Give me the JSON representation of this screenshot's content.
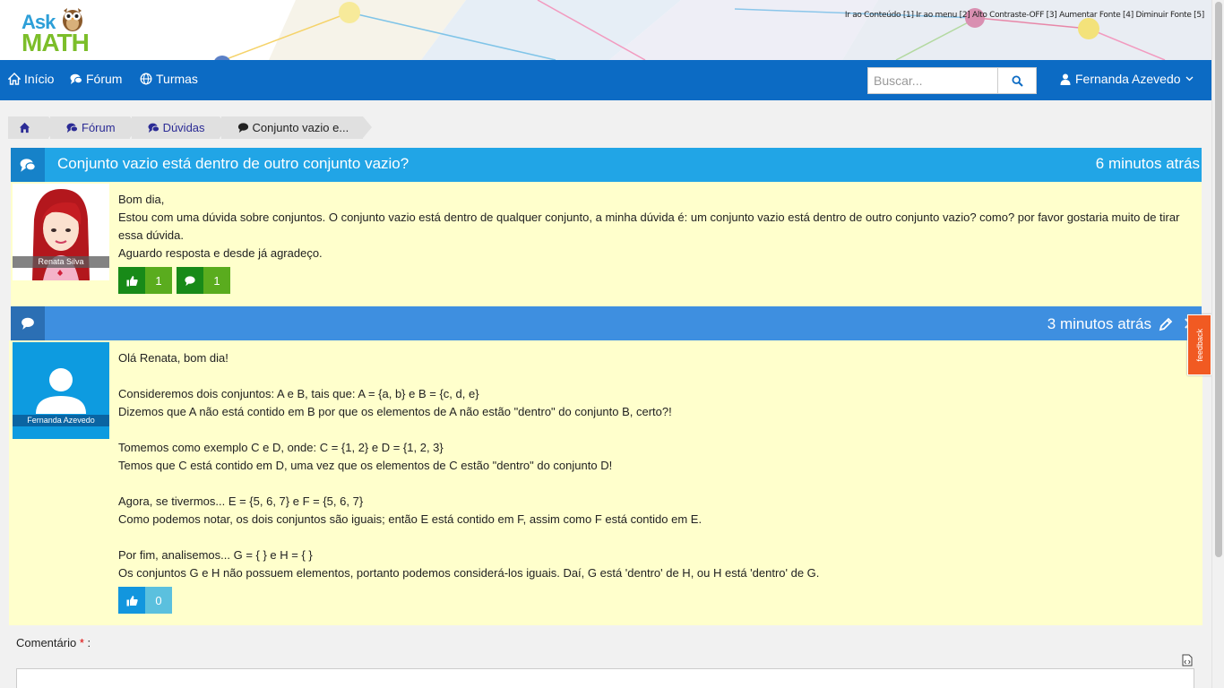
{
  "app": {
    "logo_top": "Ask",
    "logo_bottom": "MATH"
  },
  "accessibility": [
    "Ir ao Conteúdo [1]",
    "Ir ao menu [2]",
    "Alto Contraste-OFF [3]",
    "Aumentar Fonte [4]",
    "Diminuir Fonte [5]"
  ],
  "nav": {
    "home": "Início",
    "forum": "Fórum",
    "classes": "Turmas",
    "search_placeholder": "Buscar...",
    "user": "Fernanda Azevedo"
  },
  "breadcrumb": {
    "forum": "Fórum",
    "doubts": "Dúvidas",
    "current": "Conjunto vazio e..."
  },
  "question": {
    "title": "Conjunto vazio está dentro de outro conjunto vazio?",
    "time": "6 minutos atrás",
    "author": "Renata Silva",
    "lines": [
      "Bom dia,",
      "Estou com uma dúvida sobre conjuntos. O conjunto vazio está dentro de qualquer conjunto, a minha dúvida é: um conjunto vazio está dentro de outro conjunto vazio? como? por favor gostaria muito de tirar essa dúvida.",
      "Aguardo resposta e desde já agradeço."
    ],
    "likes": "1",
    "comments": "1"
  },
  "answer": {
    "time": "3 minutos atrás",
    "author": "Fernanda Azevedo",
    "lines": [
      "Olá Renata, bom dia!",
      "Consideremos dois conjuntos: A e B, tais que: A = {a, b} e B = {c, d, e}",
      "Dizemos que A não está contido em B por que os elementos de A não estão \"dentro\" do conjunto B, certo?!",
      "Tomemos como exemplo C e D, onde: C = {1, 2} e D = {1, 2, 3}",
      "Temos que C está contido em D, uma vez que os elementos de C estão \"dentro\" do conjunto D!",
      "Agora, se tivermos... E = {5, 6, 7} e F = {5, 6, 7}",
      "Como podemos notar, os dois conjuntos são iguais; então E está contido em F, assim como F está contido em E.",
      "Por fim, analisemos... G = { } e H = { }",
      "Os conjuntos G e H não possuem elementos, portanto podemos considerá-los iguais. Daí, G está 'dentro' de H, ou H está 'dentro' de G."
    ],
    "likes": "0"
  },
  "feedback_label": "feedback",
  "comment": {
    "label": "Comentário",
    "required_mark": "*",
    "colon": ":"
  },
  "colors": {
    "navbar": "#0c6bc4",
    "question_header": "#21a5e6",
    "answer_header": "#3e8fe0",
    "post_bg": "#ffffcc",
    "feedback": "#f15a22"
  }
}
